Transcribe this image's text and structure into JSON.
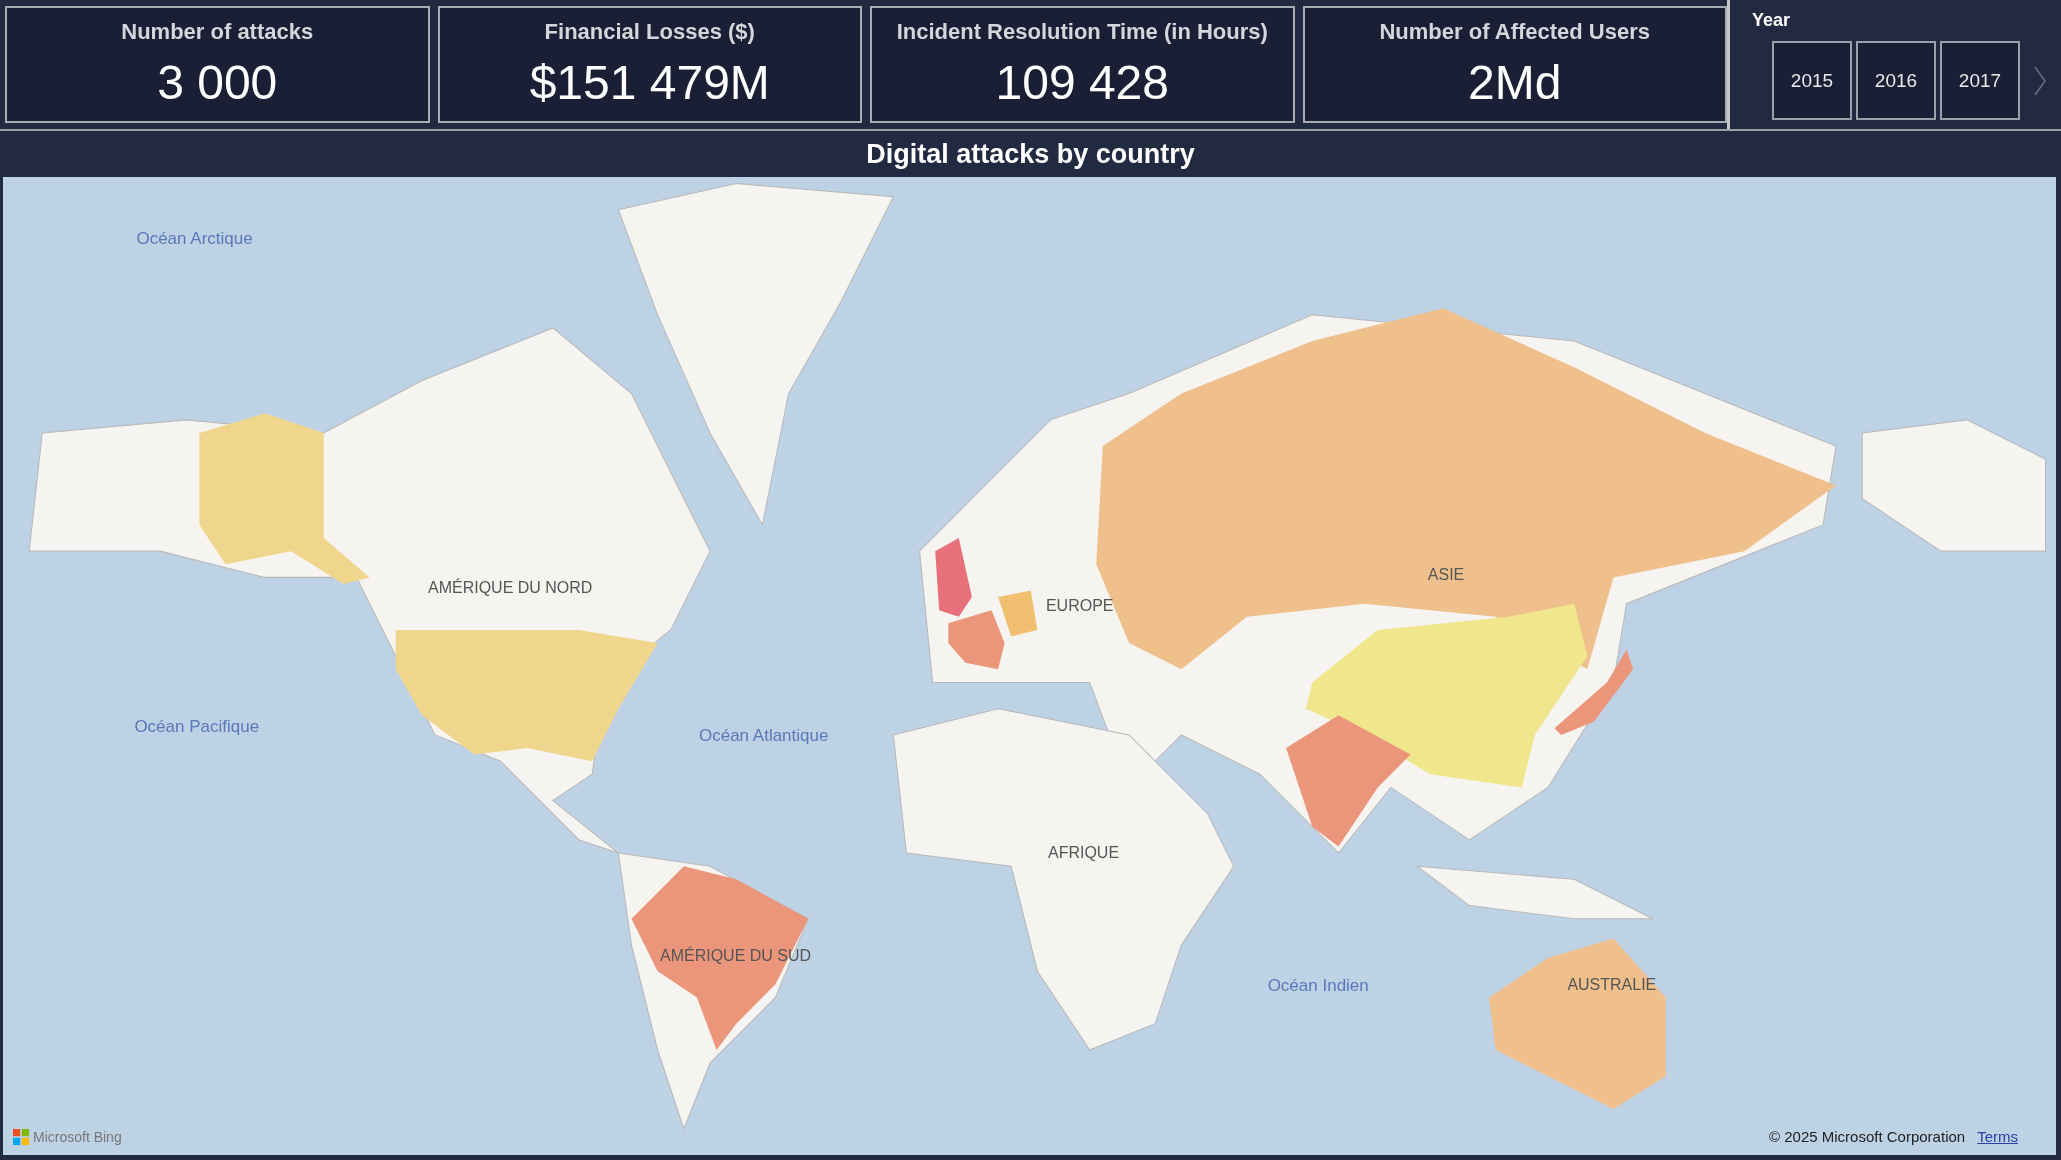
{
  "kpis": [
    {
      "label": "Number of attacks",
      "value": "3 000"
    },
    {
      "label": "Financial Losses ($)",
      "value": "$151 479M"
    },
    {
      "label": "Incident Resolution Time (in Hours)",
      "value": "109 428"
    },
    {
      "label": "Number of Affected Users",
      "value": "2Md"
    }
  ],
  "year_slicer": {
    "title": "Year",
    "options": [
      {
        "label": "2015",
        "selected": false
      },
      {
        "label": "2016",
        "selected": false
      },
      {
        "label": "2017",
        "selected": false
      }
    ]
  },
  "map": {
    "title": "Digital attacks by country",
    "regions": [
      {
        "color": "#f0d68c"
      },
      {
        "color": "#f0d68c"
      },
      {
        "color": "#e8707a"
      },
      {
        "color": "#eb967a"
      },
      {
        "color": "#f0c070"
      },
      {
        "color": "#f0c08c"
      },
      {
        "color": "#f0e68c"
      },
      {
        "color": "#eb967a"
      },
      {
        "color": "#eb967a"
      },
      {
        "color": "#eb967a"
      },
      {
        "color": "#f0c08c"
      }
    ],
    "labels": [
      {
        "text": "Océan Arctique",
        "kind": "ocean"
      },
      {
        "text": "AMÉRIQUE DU NORD",
        "kind": "continent"
      },
      {
        "text": "EUROPE",
        "kind": "continent"
      },
      {
        "text": "ASIE",
        "kind": "continent"
      },
      {
        "text": "Océan Pacifique",
        "kind": "ocean"
      },
      {
        "text": "Océan Atlantique",
        "kind": "ocean"
      },
      {
        "text": "AFRIQUE",
        "kind": "continent"
      },
      {
        "text": "AMÉRIQUE DU SUD",
        "kind": "continent"
      },
      {
        "text": "Océan Indien",
        "kind": "ocean"
      },
      {
        "text": "AUSTRALIE",
        "kind": "continent"
      }
    ],
    "logo_text": "Microsoft Bing",
    "copyright": "© 2025 Microsoft Corporation",
    "terms_link": "Terms"
  }
}
